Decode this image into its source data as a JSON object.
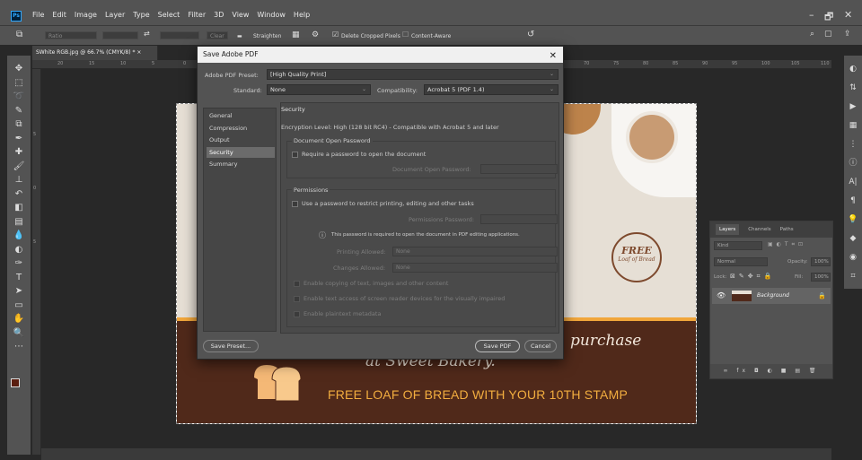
{
  "app": {
    "logo": "Ps"
  },
  "menu": [
    "File",
    "Edit",
    "Image",
    "Layer",
    "Type",
    "Select",
    "Filter",
    "3D",
    "View",
    "Window",
    "Help"
  ],
  "window_controls": {
    "minimize": "–",
    "restore": "🗗",
    "close": "✕"
  },
  "options_bar": {
    "ratio": "Ratio",
    "clear": "Clear",
    "straighten": "Straighten",
    "delete_cropped": "Delete Cropped Pixels",
    "content_aware": "Content-Aware"
  },
  "document_tab": {
    "title": "SWhite RGB.jpg @ 66.7% (CMYK/8) *",
    "close": "×"
  },
  "ruler_top": [
    "20",
    "15",
    "10",
    "5",
    "0",
    "5",
    "10",
    "70",
    "75",
    "80",
    "85",
    "90",
    "95",
    "100",
    "105",
    "110"
  ],
  "ruler_left": [
    "5",
    "0",
    "5"
  ],
  "tools": [
    "move-icon",
    "marquee-icon",
    "lasso-icon",
    "quick-select-icon",
    "crop-icon",
    "eyedropper-icon",
    "healing-icon",
    "brush-icon",
    "stamp-icon",
    "history-brush-icon",
    "eraser-icon",
    "gradient-icon",
    "blur-icon",
    "dodge-icon",
    "pen-icon",
    "type-icon",
    "path-select-icon",
    "shape-icon",
    "hand-icon",
    "zoom-icon",
    "more-icon"
  ],
  "canvas": {
    "purchase_text": "purchase",
    "sweet_text": "at Sweet Bakery.",
    "free_loaf_text": "FREE LOAF OF BREAD WITH YOUR 10TH STAMP",
    "stamp_big": "FREE",
    "stamp_small": "Loaf of Bread"
  },
  "layers_panel": {
    "tabs": [
      "Layers",
      "Channels",
      "Paths"
    ],
    "kind_placeholder": "Kind",
    "blend_mode": "Normal",
    "opacity_label": "Opacity:",
    "opacity_value": "100%",
    "lock_label": "Lock:",
    "fill_label": "Fill:",
    "fill_value": "100%",
    "layer_name": "Background",
    "bottom_icons": "∞ fx ◘ ◐ ■ ▤ 🗑"
  },
  "dialog": {
    "title": "Save Adobe PDF",
    "preset_label": "Adobe PDF Preset:",
    "preset_value": "[High Quality Print]",
    "standard_label": "Standard:",
    "standard_value": "None",
    "compat_label": "Compatibility:",
    "compat_value": "Acrobat 5 (PDF 1.4)",
    "nav": [
      "General",
      "Compression",
      "Output",
      "Security",
      "Summary"
    ],
    "selected_nav": "Security",
    "section_title": "Security",
    "encryption_text": "Encryption Level: High (128 bit RC4) - Compatible with Acrobat 5 and later",
    "doc_open_group": "Document Open Password",
    "require_password": "Require a password to open the document",
    "doc_open_password_label": "Document Open Password:",
    "permissions_group": "Permissions",
    "use_password": "Use a password to restrict printing, editing and other tasks",
    "permissions_password_label": "Permissions Password:",
    "info_text": "This password is required to open the document in PDF editing applications.",
    "printing_label": "Printing Allowed:",
    "printing_value": "None",
    "changes_label": "Changes Allowed:",
    "changes_value": "None",
    "enable_copying": "Enable copying of text, images and other content",
    "enable_access": "Enable text access of screen reader devices for the visually impaired",
    "enable_metadata": "Enable plaintext metadata",
    "save_preset": "Save Preset...",
    "save_pdf": "Save PDF",
    "cancel": "Cancel"
  },
  "colors": {
    "accent": "#31a8ff",
    "brown": "#50291a",
    "orange": "#f1a63b"
  }
}
